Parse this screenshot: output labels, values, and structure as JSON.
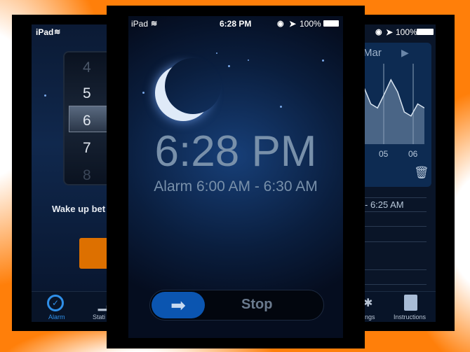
{
  "left_screen": {
    "status_device": "iPad",
    "picker_values": [
      "4",
      "5",
      "6",
      "7",
      "8"
    ],
    "selected": "6",
    "wake_text": "Wake up bet",
    "tabs": [
      {
        "label": "Alarm",
        "icon": "alarm-clock-icon",
        "active": true
      },
      {
        "label": "Stati",
        "icon": "bar-chart-icon"
      }
    ],
    "accent": "#2f8fe8",
    "button_color": "#dd7000"
  },
  "center_screen": {
    "status_device": "iPad",
    "status_time": "6:28 PM",
    "battery": "100%",
    "time": "6:28 PM",
    "alarm_window": "Alarm 6:00 AM - 6:30 AM",
    "slider_label": "Stop",
    "slider_color": "#0b55b0"
  },
  "right_screen": {
    "battery": "100%",
    "month": "Mar",
    "x_ticks": [
      "05",
      "06"
    ],
    "sleep_levels": [
      0.75,
      0.8,
      0.7,
      0.5,
      0.45,
      0.62,
      0.8,
      0.65,
      0.4,
      0.35,
      0.5,
      0.45
    ],
    "list_text": "- 6:25 AM",
    "tabs": [
      {
        "label": "ngs",
        "icon": "gear-icon"
      },
      {
        "label": "Instructions",
        "icon": "book-icon"
      }
    ]
  }
}
